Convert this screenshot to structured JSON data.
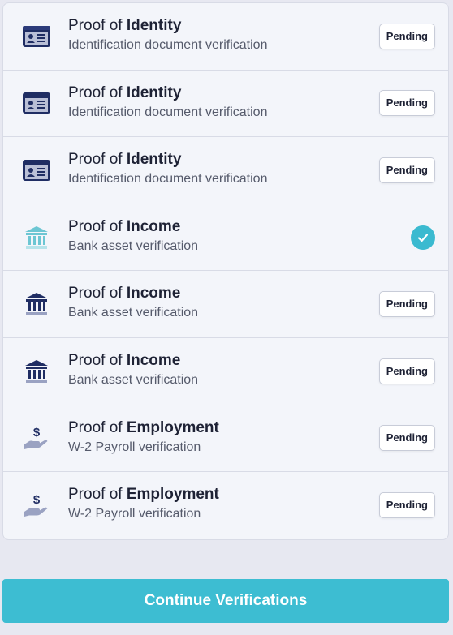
{
  "verifications": [
    {
      "title_prefix": "Proof of",
      "title_bold": "Identity",
      "subtitle": "Identification document verification",
      "icon": "id-card-icon",
      "status": "Pending",
      "completed": false
    },
    {
      "title_prefix": "Proof of",
      "title_bold": "Identity",
      "subtitle": "Identification document verification",
      "icon": "id-card-icon",
      "status": "Pending",
      "completed": false
    },
    {
      "title_prefix": "Proof of",
      "title_bold": "Identity",
      "subtitle": "Identification document verification",
      "icon": "id-card-icon",
      "status": "Pending",
      "completed": false
    },
    {
      "title_prefix": "Proof of",
      "title_bold": "Income",
      "subtitle": "Bank asset verification",
      "icon": "bank-icon",
      "status": "",
      "completed": true
    },
    {
      "title_prefix": "Proof of",
      "title_bold": "Income",
      "subtitle": "Bank asset verification",
      "icon": "bank-icon",
      "status": "Pending",
      "completed": false
    },
    {
      "title_prefix": "Proof of",
      "title_bold": "Income",
      "subtitle": "Bank asset verification",
      "icon": "bank-icon",
      "status": "Pending",
      "completed": false
    },
    {
      "title_prefix": "Proof of",
      "title_bold": "Employment",
      "subtitle": "W-2 Payroll verification",
      "icon": "payroll-hand-icon",
      "status": "Pending",
      "completed": false
    },
    {
      "title_prefix": "Proof of",
      "title_bold": "Employment",
      "subtitle": "W-2 Payroll verification",
      "icon": "payroll-hand-icon",
      "status": "Pending",
      "completed": false
    }
  ],
  "continue_button": {
    "label": "Continue Verifications"
  },
  "colors": {
    "accent": "#3dbdd2",
    "icon_navy": "#1f2d63",
    "icon_completed": "#6cc6d3"
  }
}
